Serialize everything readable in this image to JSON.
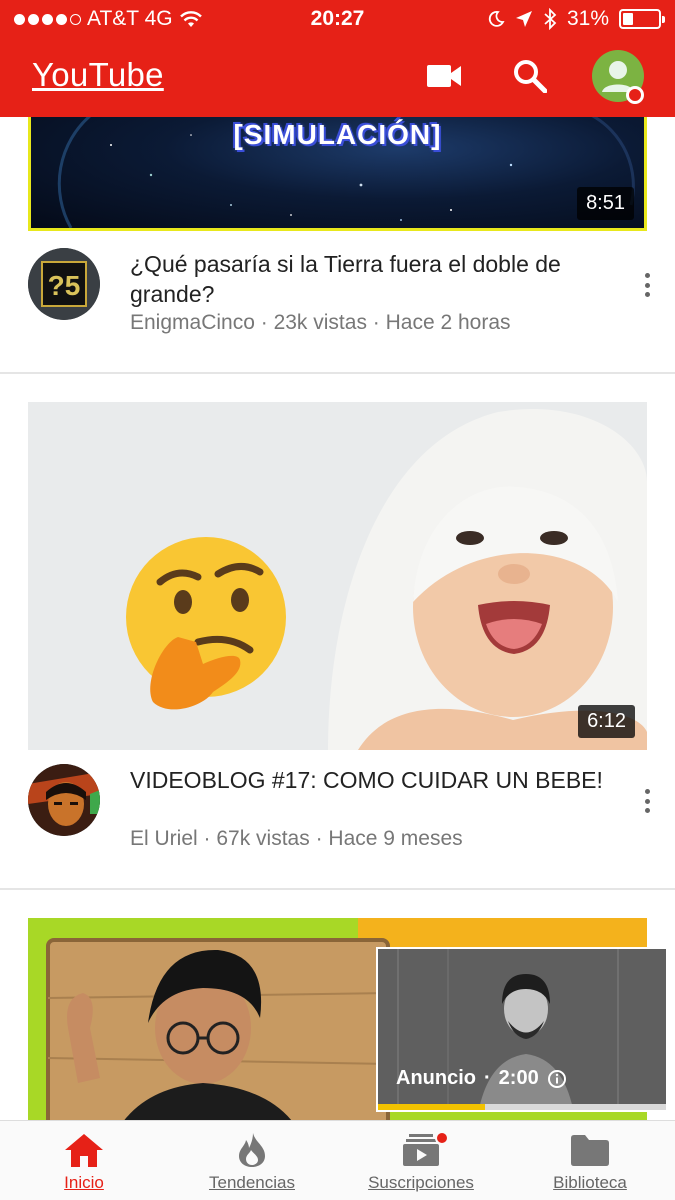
{
  "status_bar": {
    "carrier": "AT&T 4G",
    "time": "20:27",
    "battery": "31%"
  },
  "header": {
    "logo": "YouTube",
    "icons": [
      "video-camera-icon",
      "search-icon",
      "account-avatar-icon"
    ]
  },
  "videos": [
    {
      "thumb_text": "[SIMULACIÓN]",
      "duration": "8:51",
      "title": "¿Qué pasaría si la Tierra fuera el doble de grande?",
      "channel": "EnigmaCinco",
      "views": "23k vistas",
      "age": "Hace 2 horas",
      "channel_avatar_text": "?5"
    },
    {
      "duration": "6:12",
      "title": "VIDEOBLOG #17: COMO CUIDAR UN BEBE!",
      "channel": "El Uriel",
      "views": "67k vistas",
      "age": "Hace 9 meses"
    }
  ],
  "mini_player": {
    "label": "Anuncio",
    "time": "2:00",
    "progress": 0.37
  },
  "tabs": [
    {
      "label": "Inicio",
      "icon": "home-icon",
      "active": true
    },
    {
      "label": "Tendencias",
      "icon": "flame-icon",
      "active": false
    },
    {
      "label": "Suscripciones",
      "icon": "subscriptions-icon",
      "active": false
    },
    {
      "label": "Biblioteca",
      "icon": "folder-icon",
      "active": false
    }
  ],
  "colors": {
    "brand_red": "#e62117",
    "text": "#222222",
    "meta_text": "#777777"
  }
}
